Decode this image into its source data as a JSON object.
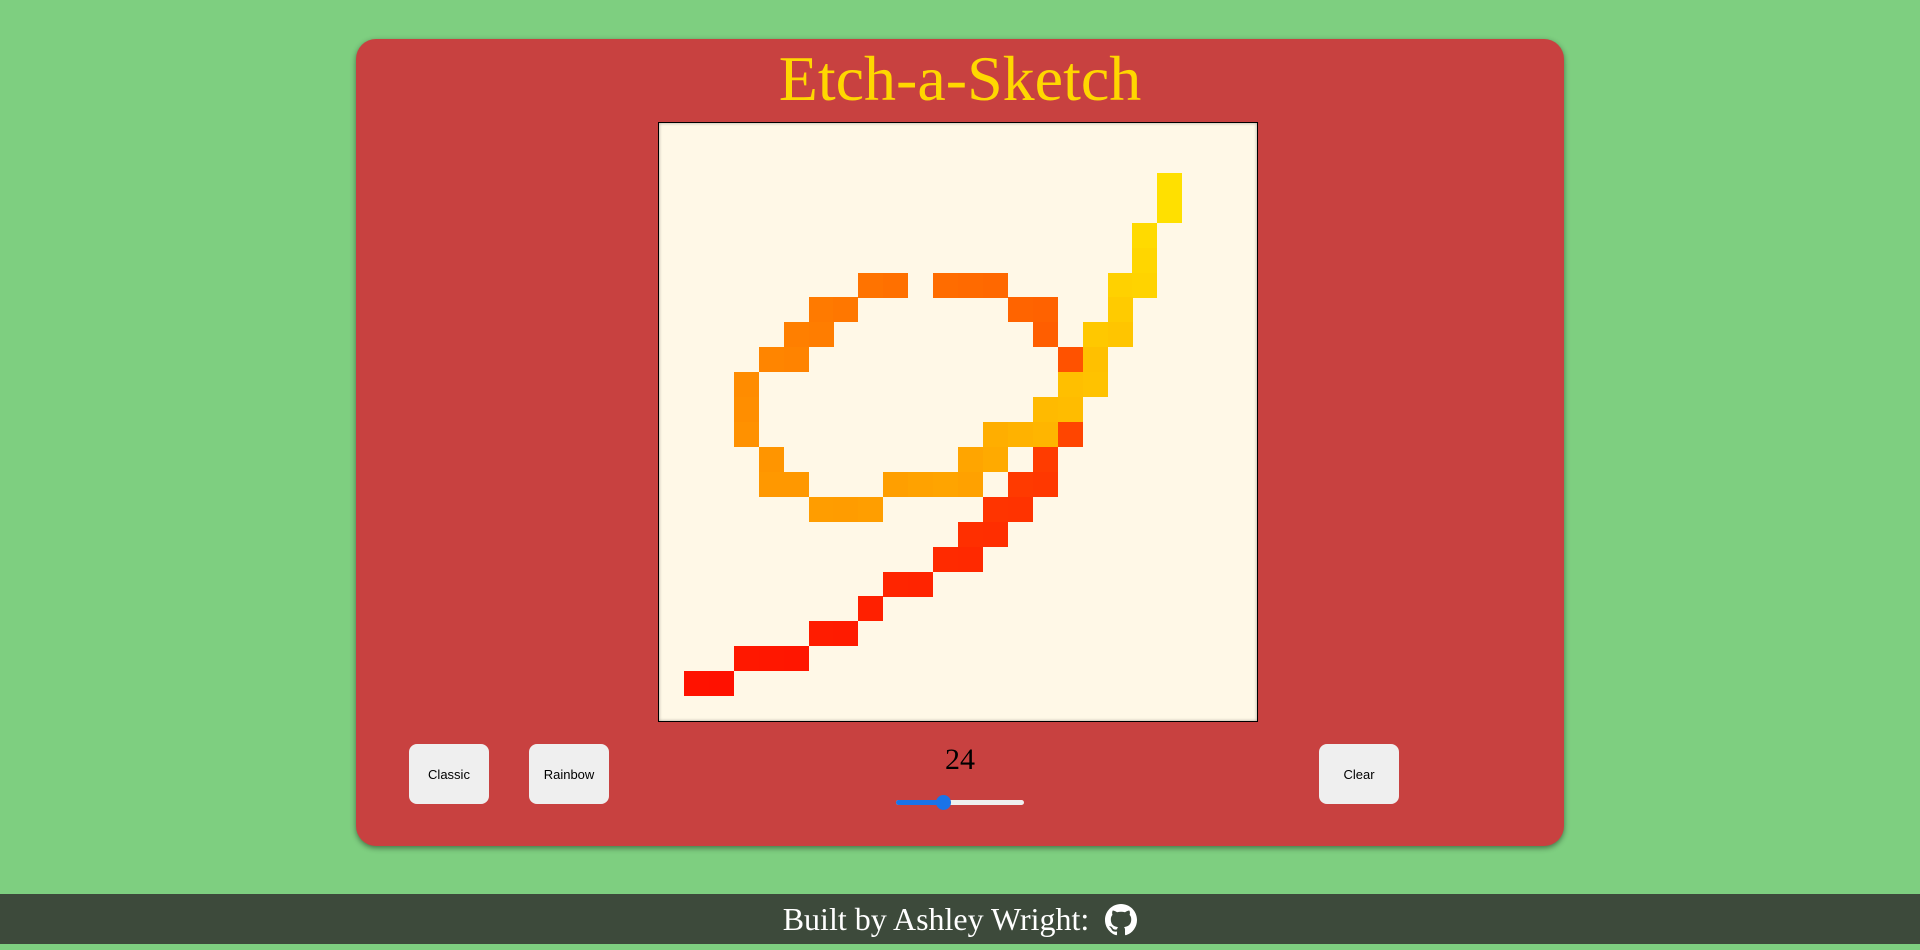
{
  "app": {
    "title": "Etch-a-Sketch",
    "colors": {
      "page_background": "#7ecf80",
      "frame": "#c84140",
      "title": "#ffd700",
      "board_background": "#fff8e7",
      "footer_background": "#3d4a3b"
    }
  },
  "board": {
    "grid_size": 24,
    "filled_cells": [
      {
        "col": 20,
        "row": 2,
        "color": "#ffe000"
      },
      {
        "col": 20,
        "row": 3,
        "color": "#ffe000"
      },
      {
        "col": 19,
        "row": 4,
        "color": "#ffda00"
      },
      {
        "col": 19,
        "row": 5,
        "color": "#ffd600"
      },
      {
        "col": 18,
        "row": 6,
        "color": "#ffd100"
      },
      {
        "col": 19,
        "row": 6,
        "color": "#ffd300"
      },
      {
        "col": 18,
        "row": 7,
        "color": "#ffcb00"
      },
      {
        "col": 17,
        "row": 8,
        "color": "#ffc800"
      },
      {
        "col": 18,
        "row": 8,
        "color": "#ffc500"
      },
      {
        "col": 16,
        "row": 10,
        "color": "#ffbf00"
      },
      {
        "col": 17,
        "row": 9,
        "color": "#ffc000"
      },
      {
        "col": 17,
        "row": 10,
        "color": "#ffc200"
      },
      {
        "col": 15,
        "row": 11,
        "color": "#ffba00"
      },
      {
        "col": 16,
        "row": 11,
        "color": "#ffbc00"
      },
      {
        "col": 15,
        "row": 12,
        "color": "#ffb500"
      },
      {
        "col": 12,
        "row": 13,
        "color": "#ffa500"
      },
      {
        "col": 13,
        "row": 12,
        "color": "#ffae00"
      },
      {
        "col": 13,
        "row": 13,
        "color": "#ffaa00"
      },
      {
        "col": 14,
        "row": 12,
        "color": "#ffb200"
      },
      {
        "col": 9,
        "row": 14,
        "color": "#ff9f00"
      },
      {
        "col": 10,
        "row": 14,
        "color": "#ffa200"
      },
      {
        "col": 11,
        "row": 14,
        "color": "#ffa400"
      },
      {
        "col": 12,
        "row": 14,
        "color": "#ffa100"
      },
      {
        "col": 6,
        "row": 15,
        "color": "#ff9d00"
      },
      {
        "col": 7,
        "row": 15,
        "color": "#ff9c00"
      },
      {
        "col": 8,
        "row": 15,
        "color": "#ff9e00"
      },
      {
        "col": 4,
        "row": 14,
        "color": "#ff9800"
      },
      {
        "col": 5,
        "row": 14,
        "color": "#ff9800"
      },
      {
        "col": 4,
        "row": 13,
        "color": "#ff9500"
      },
      {
        "col": 3,
        "row": 10,
        "color": "#ff8c00"
      },
      {
        "col": 3,
        "row": 11,
        "color": "#ff8e00"
      },
      {
        "col": 3,
        "row": 12,
        "color": "#ff9100"
      },
      {
        "col": 4,
        "row": 9,
        "color": "#ff8500"
      },
      {
        "col": 5,
        "row": 9,
        "color": "#ff8300"
      },
      {
        "col": 5,
        "row": 8,
        "color": "#ff7f00"
      },
      {
        "col": 6,
        "row": 8,
        "color": "#ff7d00"
      },
      {
        "col": 6,
        "row": 7,
        "color": "#ff7a00"
      },
      {
        "col": 7,
        "row": 7,
        "color": "#ff7700"
      },
      {
        "col": 8,
        "row": 6,
        "color": "#ff7300"
      },
      {
        "col": 9,
        "row": 6,
        "color": "#ff7000"
      },
      {
        "col": 11,
        "row": 6,
        "color": "#ff6c00"
      },
      {
        "col": 12,
        "row": 6,
        "color": "#ff6a00"
      },
      {
        "col": 13,
        "row": 6,
        "color": "#ff6800"
      },
      {
        "col": 14,
        "row": 7,
        "color": "#ff6400"
      },
      {
        "col": 15,
        "row": 7,
        "color": "#ff6200"
      },
      {
        "col": 15,
        "row": 8,
        "color": "#ff5e00"
      },
      {
        "col": 16,
        "row": 9,
        "color": "#ff5200"
      },
      {
        "col": 16,
        "row": 12,
        "color": "#ff4500"
      },
      {
        "col": 15,
        "row": 13,
        "color": "#ff3c00"
      },
      {
        "col": 14,
        "row": 14,
        "color": "#ff3a00"
      },
      {
        "col": 15,
        "row": 14,
        "color": "#ff3800"
      },
      {
        "col": 13,
        "row": 15,
        "color": "#ff3400"
      },
      {
        "col": 14,
        "row": 15,
        "color": "#ff3300"
      },
      {
        "col": 12,
        "row": 16,
        "color": "#ff2f00"
      },
      {
        "col": 13,
        "row": 16,
        "color": "#ff2e00"
      },
      {
        "col": 11,
        "row": 17,
        "color": "#ff2a00"
      },
      {
        "col": 12,
        "row": 17,
        "color": "#ff2900"
      },
      {
        "col": 9,
        "row": 18,
        "color": "#ff2500"
      },
      {
        "col": 10,
        "row": 18,
        "color": "#ff2400"
      },
      {
        "col": 8,
        "row": 19,
        "color": "#ff2000"
      },
      {
        "col": 6,
        "row": 20,
        "color": "#ff1c00"
      },
      {
        "col": 7,
        "row": 20,
        "color": "#ff1b00"
      },
      {
        "col": 3,
        "row": 21,
        "color": "#ff1800"
      },
      {
        "col": 4,
        "row": 21,
        "color": "#ff1700"
      },
      {
        "col": 5,
        "row": 21,
        "color": "#ff1600"
      },
      {
        "col": 1,
        "row": 22,
        "color": "#ff1200"
      },
      {
        "col": 2,
        "row": 22,
        "color": "#ff1100"
      }
    ]
  },
  "controls": {
    "classic_label": "Classic",
    "rainbow_label": "Rainbow",
    "clear_label": "Clear",
    "size_value": "24",
    "slider_fraction": 0.37,
    "slider_color": "#1a73e8"
  },
  "footer": {
    "text": "Built by Ashley Wright:",
    "icon": "github-icon"
  }
}
